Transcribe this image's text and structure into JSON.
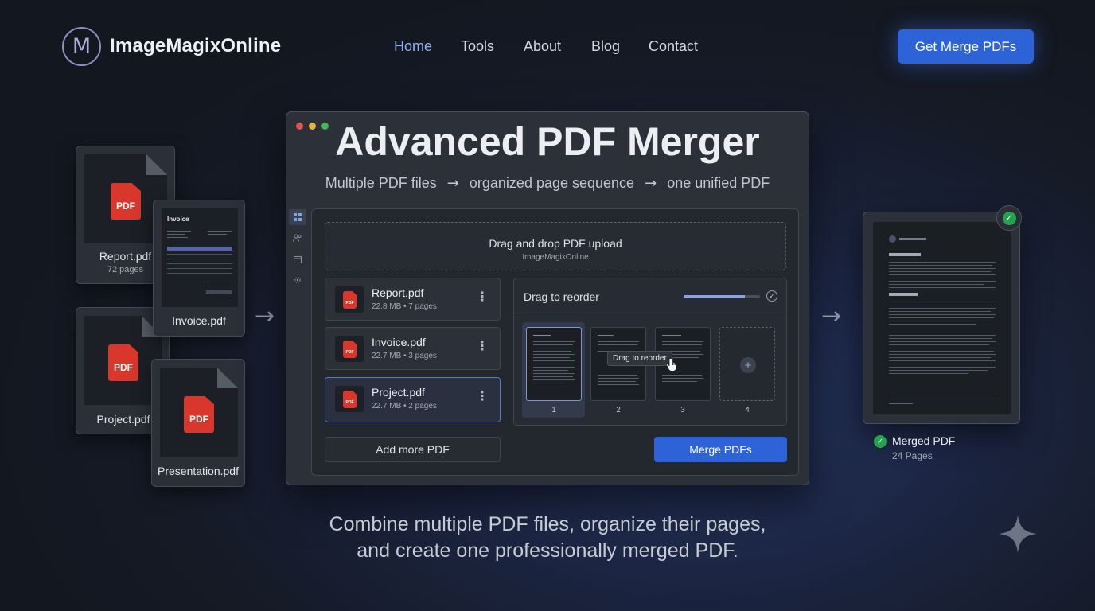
{
  "header": {
    "logo_letter": "M",
    "brand": "ImageMagixOnline",
    "nav": [
      "Home",
      "Tools",
      "About",
      "Blog",
      "Contact"
    ],
    "active_nav": "Home",
    "cta_label": "Get Merge PDFs"
  },
  "source_files": [
    {
      "name": "Report.pdf",
      "pages": "72 pages",
      "icon_label": "PDF"
    },
    {
      "name": "Invoice.pdf",
      "heading": "Invoice"
    },
    {
      "name": "Project.pdf",
      "icon_label": "PDF"
    },
    {
      "name": "Presentation.pdf",
      "icon_label": "PDF"
    }
  ],
  "window": {
    "title": "Advanced PDF Merger",
    "subtitle_parts": [
      "Multiple PDF files",
      "organized page sequence",
      "one unified PDF"
    ],
    "arrow_glyph": "→",
    "dropzone": {
      "title": "Drag and drop PDF upload",
      "subtitle": "ImageMagixOnline"
    },
    "files": [
      {
        "name": "Report.pdf",
        "meta": "22.8 MB • 7 pages",
        "icon_label": "PDF"
      },
      {
        "name": "Invoice.pdf",
        "meta": "22.7 MB • 3 pages",
        "icon_label": "PDF"
      },
      {
        "name": "Project.pdf",
        "meta": "22.7 MB • 2 pages",
        "icon_label": "PDF"
      }
    ],
    "add_more_label": "Add more PDF",
    "reorder": {
      "title": "Drag to reorder",
      "progress": 0.8,
      "tooltip": "Drag to reorder",
      "page_numbers": [
        "1",
        "2",
        "3",
        "4"
      ]
    },
    "merge_label": "Merge PDFs"
  },
  "result": {
    "name": "Merged PDF",
    "pages": "24 Pages"
  },
  "tagline": [
    "Combine multiple PDF files, organize their pages,",
    "and create one professionally merged PDF."
  ],
  "colors": {
    "accent": "#2e63d8",
    "success": "#24a24e",
    "pdf_red": "#d9362c",
    "active_nav": "#8fb2ee"
  }
}
